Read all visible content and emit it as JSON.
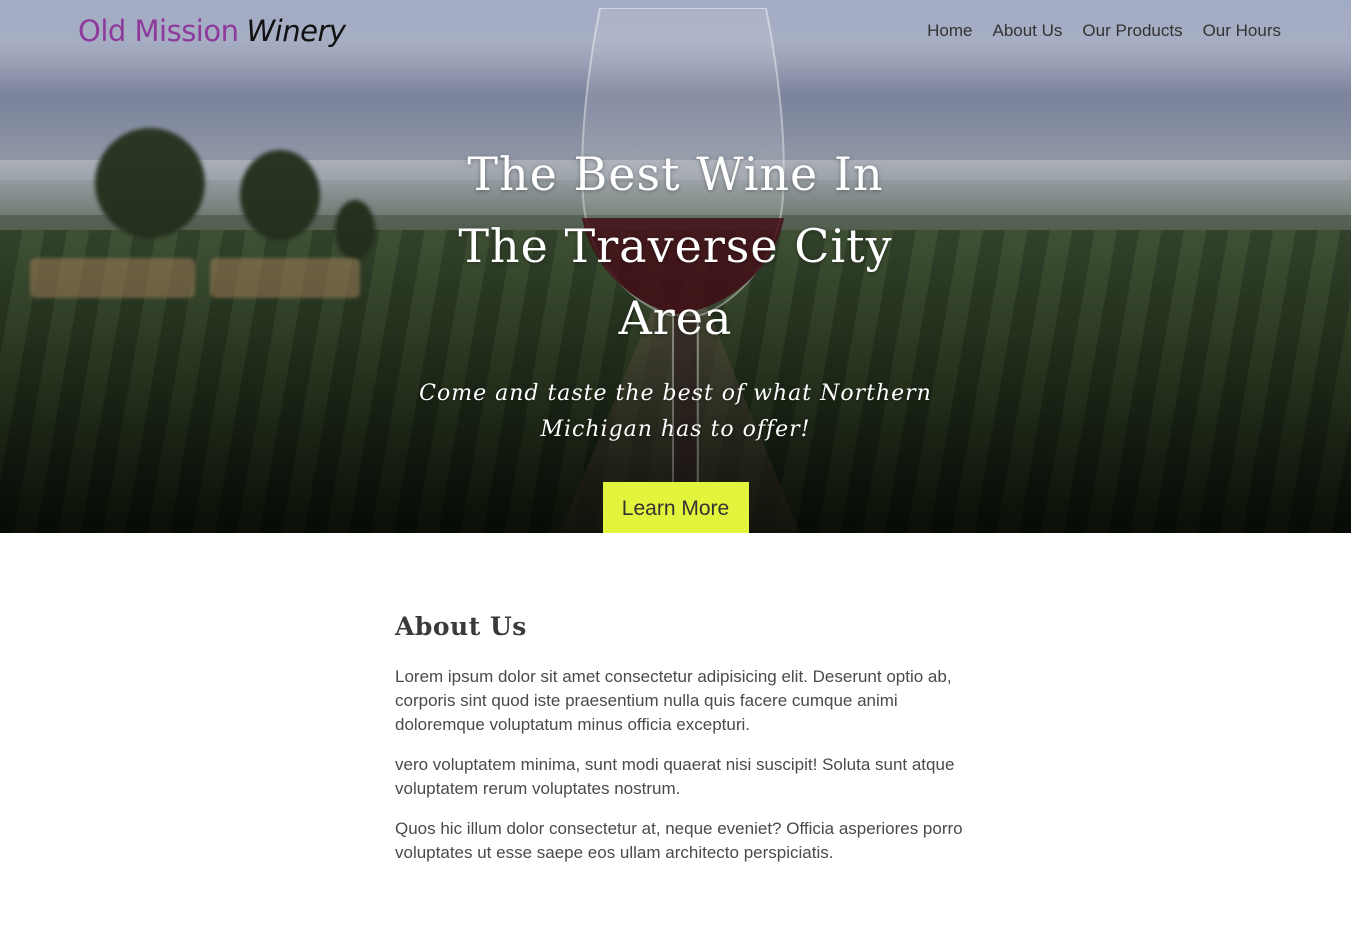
{
  "brand": {
    "part1": "Old Mission",
    "part2": "Winery"
  },
  "nav": {
    "items": [
      {
        "label": "Home"
      },
      {
        "label": "About Us"
      },
      {
        "label": "Our Products"
      },
      {
        "label": "Our Hours"
      }
    ]
  },
  "hero": {
    "title": "The Best Wine In The Traverse City Area",
    "subtitle": "Come and taste the best of what Northern Michigan has to offer!",
    "cta_label": "Learn More",
    "cta_color": "#e3f43d"
  },
  "about": {
    "heading": "About Us",
    "paragraphs": [
      "Lorem ipsum dolor sit amet consectetur adipisicing elit. Deserunt optio ab, corporis sint quod iste praesentium nulla quis facere cumque animi doloremque voluptatum minus officia excepturi.",
      "vero voluptatem minima, sunt modi quaerat nisi suscipit! Soluta sunt atque voluptatem rerum voluptates nostrum.",
      "Quos hic illum dolor consectetur at, neque eveniet? Officia asperiores porro voluptates ut esse saepe eos ullam architecto perspiciatis."
    ]
  },
  "colors": {
    "brand_accent": "#8e3a9d"
  }
}
